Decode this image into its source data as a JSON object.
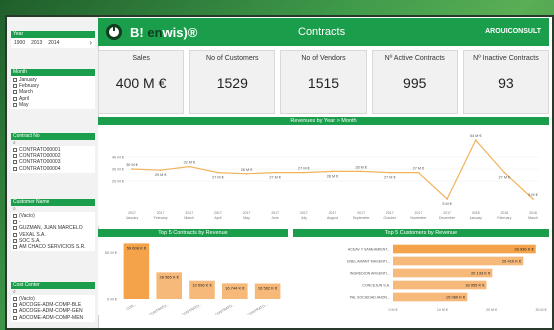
{
  "sidebar": {
    "year_slicer": {
      "title": "Year",
      "years": [
        "1900",
        "2013",
        "2014"
      ]
    },
    "month_slicer": {
      "title": "Month",
      "items": [
        "January",
        "February",
        "March",
        "April",
        "May"
      ]
    },
    "contract_slicer": {
      "title": "Contract No",
      "items": [
        "CONTRATO00001",
        "CONTRATO00002",
        "CONTRATO00003",
        "CONTRATO00004"
      ]
    },
    "customer_slicer": {
      "title": "Customer Name",
      "items": [
        "(Vacío)",
        "-",
        "GUZMAN, JUAN MARCELO",
        "VEXAL S.A.",
        "SOC S.A.",
        "AM CHACO SERVICIOS S.R."
      ]
    },
    "cost_slicer": {
      "title": "Cost Center",
      "items": [
        "(Vacío)",
        "ADCOGE-ADM-COMP-BLE",
        "ADCOGE-ADM-COMP-GEN",
        "ADCOME-ADM-COMP-MEN"
      ]
    }
  },
  "header": {
    "brand_prefix": "B! ",
    "brand_em": "en",
    "brand_suffix": "wis)®",
    "title": "Contracts",
    "user": "AROUICONSULT"
  },
  "kpis": [
    {
      "label": "Sales",
      "value": "400 M €"
    },
    {
      "label": "No of Customers",
      "value": "1529"
    },
    {
      "label": "No of Vendors",
      "value": "1515"
    },
    {
      "label": "Nº Active Contracts",
      "value": "995"
    },
    {
      "label": "Nº Inactive Contracts",
      "value": "93"
    }
  ],
  "colors": {
    "accent": "#1b9e4b",
    "line": "#f2b35c",
    "bar": "#f5a34a",
    "bar_light": "#f7b97a"
  },
  "chart_data": [
    {
      "type": "line",
      "title": "Revenues by Year > Month",
      "x": [
        "2017 January",
        "2017 February",
        "2017 March",
        "2017 April",
        "2017 May",
        "2017 June",
        "2017 July",
        "2017 August",
        "2017 September",
        "2017 October",
        "2017 November",
        "2017 December",
        "2018 January",
        "2018 February",
        "2018 March"
      ],
      "values": [
        30,
        29,
        32,
        27,
        26,
        27,
        27,
        28,
        28,
        27,
        27,
        5,
        54,
        27,
        5
      ],
      "data_labels": [
        "30 M €",
        "29 M €",
        "32 M €",
        "27 M €",
        "26 M €",
        "27 M €",
        "27 M €",
        "28 M €",
        "28 M €",
        "27 M €",
        "27 M €",
        "5 M €",
        "54 M €",
        "27 M €",
        "5 M €"
      ],
      "y_ticks": [
        "40 M €",
        "30 M €",
        "20 M €"
      ],
      "ylim": [
        0,
        60
      ]
    },
    {
      "type": "bar",
      "title": "Top 5 Contracts by Revenue",
      "categories": [
        "CON...",
        "CONTRATO...",
        "CONTRATO...",
        "CONTRATO...",
        "CONTRATO..."
      ],
      "values": [
        59608,
        28565,
        19596,
        16744,
        16562
      ],
      "data_labels": [
        "59 608 K €",
        "28 565 K €",
        "19 596 K €",
        "16 744 K €",
        "16 562 K €"
      ],
      "y_ticks": [
        "50 M €",
        "0 M €"
      ]
    },
    {
      "type": "bar",
      "title": "Top 5 Customers by Revenue",
      "categories": [
        "ACEAV Y SANEAMIENT...",
        "ENEL AMANT MAGENTI...",
        "INGREDION ARGENTI...",
        "CONCEJUN S.A.",
        "PAL SOCIEDAD ANON..."
      ],
      "values": [
        28936,
        26410,
        20133,
        18955,
        15060
      ],
      "data_labels": [
        "28 936 K €",
        "26 410 K €",
        "20 133 K €",
        "18 955 K €",
        "15 060 K €"
      ],
      "x_ticks": [
        "0 M €",
        "10 M €",
        "20 M €",
        "30 M €"
      ]
    }
  ]
}
